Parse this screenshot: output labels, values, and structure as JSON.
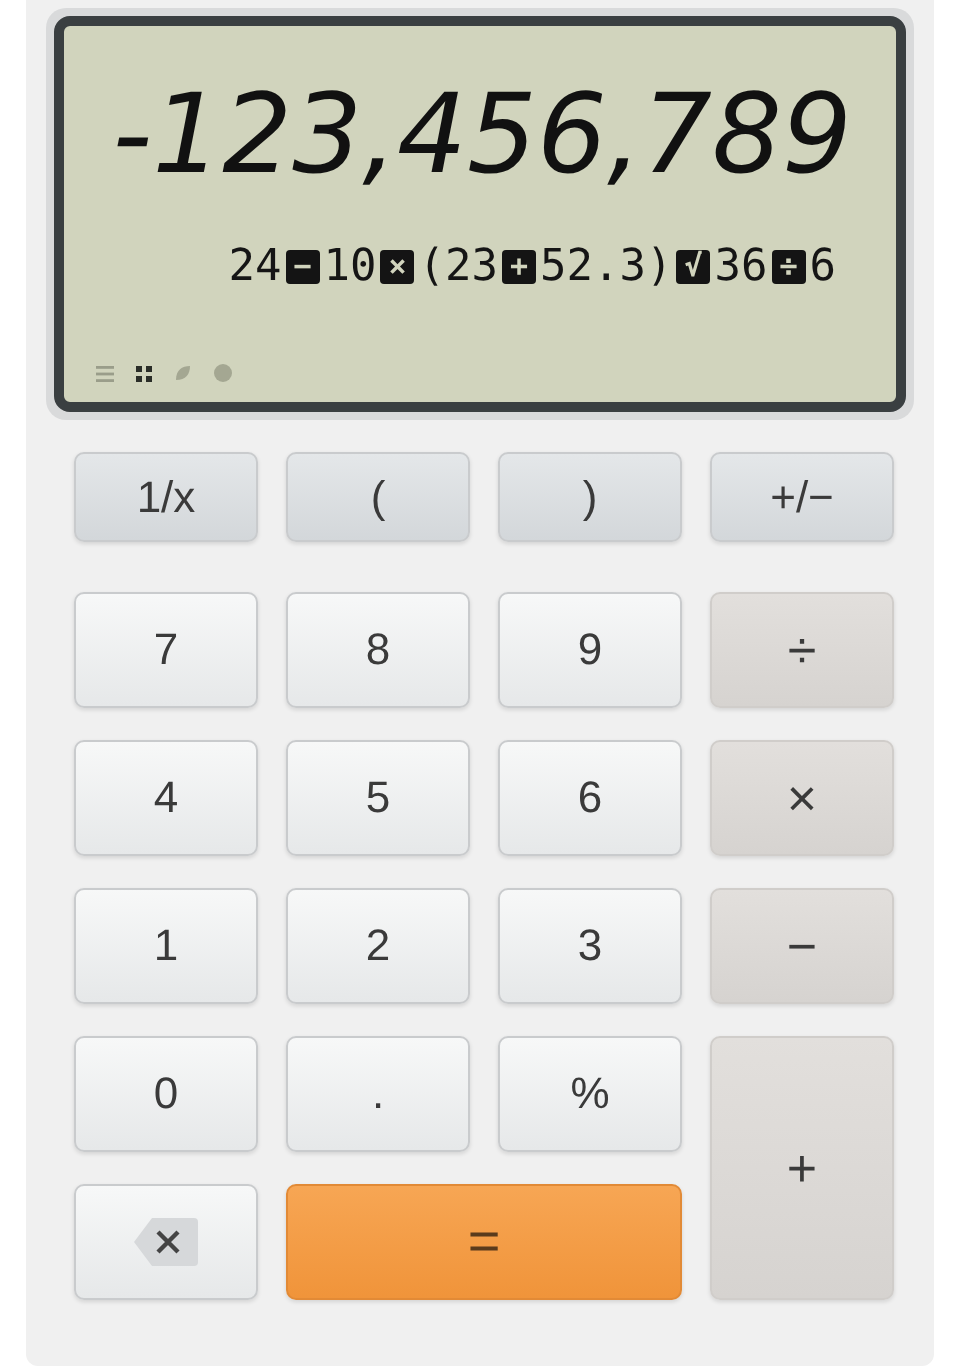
{
  "display": {
    "value": "-123,456,789",
    "expression": [
      {
        "kind": "number",
        "text": "24"
      },
      {
        "kind": "operator",
        "text": "−"
      },
      {
        "kind": "number",
        "text": "10"
      },
      {
        "kind": "operator",
        "text": "×"
      },
      {
        "kind": "number",
        "text": "(23"
      },
      {
        "kind": "operator",
        "text": "+"
      },
      {
        "kind": "number",
        "text": "52.3)"
      },
      {
        "kind": "operator",
        "text": "√"
      },
      {
        "kind": "number",
        "text": "36"
      },
      {
        "kind": "operator",
        "text": "÷"
      },
      {
        "kind": "number",
        "text": "6"
      }
    ]
  },
  "function_keys": [
    {
      "kind": "function",
      "label": "1/x"
    },
    {
      "kind": "function",
      "label": "("
    },
    {
      "kind": "function",
      "label": ")"
    },
    {
      "kind": "function",
      "label": "+/−"
    }
  ],
  "keys": [
    {
      "kind": "digit",
      "label": "7"
    },
    {
      "kind": "digit",
      "label": "8"
    },
    {
      "kind": "digit",
      "label": "9"
    },
    {
      "kind": "operator",
      "label": "÷"
    },
    {
      "kind": "digit",
      "label": "4"
    },
    {
      "kind": "digit",
      "label": "5"
    },
    {
      "kind": "digit",
      "label": "6"
    },
    {
      "kind": "operator",
      "label": "×"
    },
    {
      "kind": "digit",
      "label": "1"
    },
    {
      "kind": "digit",
      "label": "2"
    },
    {
      "kind": "digit",
      "label": "3"
    },
    {
      "kind": "operator",
      "label": "−"
    },
    {
      "kind": "digit",
      "label": "0"
    },
    {
      "kind": "digit",
      "label": "."
    },
    {
      "kind": "digit",
      "label": "%"
    },
    {
      "kind": "tall-operator",
      "label": "+"
    },
    {
      "kind": "backspace"
    },
    {
      "kind": "equals",
      "label": "="
    }
  ]
}
